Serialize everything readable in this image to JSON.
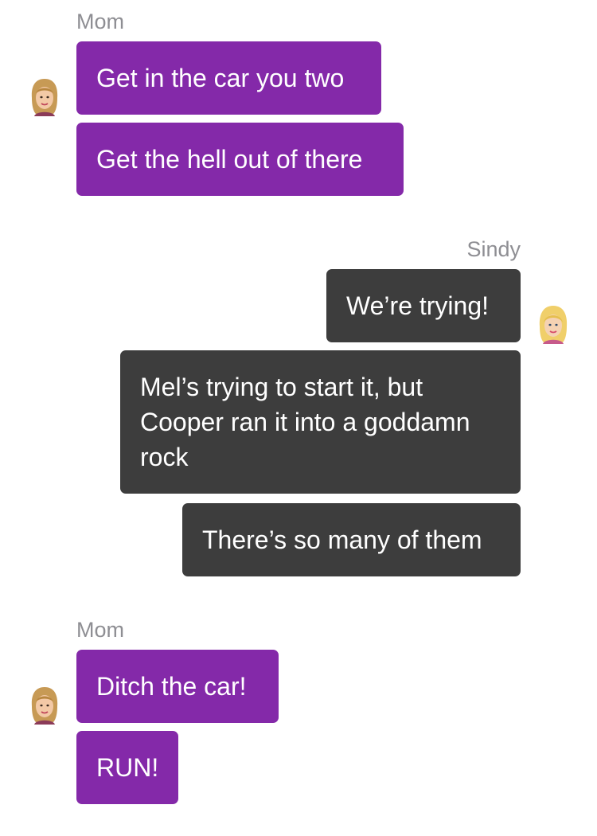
{
  "conversation": {
    "groups": [
      {
        "sender": "Mom",
        "avatar_icon": "mom-avatar-icon",
        "messages": [
          "Get in the car you two",
          "Get the hell out of there"
        ]
      },
      {
        "sender": "Sindy",
        "avatar_icon": "sindy-avatar-icon",
        "messages": [
          "We’re trying!",
          "Mel’s trying to start it, but Cooper ran it into a goddamn rock",
          "There’s so many of them"
        ]
      },
      {
        "sender": "Mom",
        "avatar_icon": "mom-avatar-icon",
        "messages": [
          "Ditch the car!",
          "RUN!"
        ]
      }
    ]
  },
  "colors": {
    "mom_bubble": "#8429a9",
    "sindy_bubble": "#3d3d3d",
    "sender_label": "#8e8e93",
    "message_text": "#ffffff",
    "background": "#ffffff"
  }
}
